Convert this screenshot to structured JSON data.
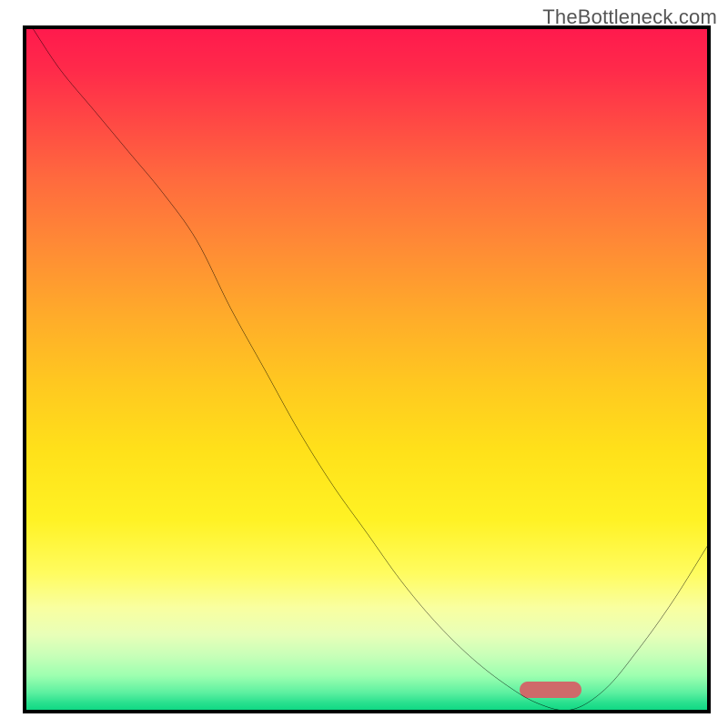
{
  "watermark": "TheBottleneck.com",
  "chart_data": {
    "type": "line",
    "title": "",
    "xlabel": "",
    "ylabel": "",
    "xlim": [
      0,
      100
    ],
    "ylim": [
      0,
      100
    ],
    "grid": false,
    "legend": false,
    "note": "Axes are unlabeled; coordinates below are expressed as percentages of the plot area (x: left→right, y: bottom→top). Values are estimated from the rendered curve and rounded to the nearest integer.",
    "series": [
      {
        "name": "bottleneck-curve",
        "x": [
          1,
          5,
          10,
          15,
          20,
          25,
          30,
          35,
          40,
          45,
          50,
          55,
          60,
          65,
          70,
          75,
          80,
          85,
          90,
          95,
          100
        ],
        "values": [
          100,
          94,
          88,
          82,
          76,
          69,
          59,
          50,
          41,
          33,
          26,
          19,
          13,
          8,
          4,
          1,
          0,
          3,
          9,
          16,
          24
        ]
      }
    ],
    "marker": {
      "name": "optimal-range",
      "shape": "pill",
      "color": "#cf6a6a",
      "x_center": 77,
      "y": 2,
      "width_pct": 9
    },
    "background_gradient": {
      "direction": "vertical",
      "stops": [
        {
          "pct": 0,
          "color": "#ff1a4d"
        },
        {
          "pct": 20,
          "color": "#ff6a3e"
        },
        {
          "pct": 45,
          "color": "#ffc820"
        },
        {
          "pct": 70,
          "color": "#fff224"
        },
        {
          "pct": 88,
          "color": "#e8ffb8"
        },
        {
          "pct": 100,
          "color": "#10d884"
        }
      ]
    }
  }
}
